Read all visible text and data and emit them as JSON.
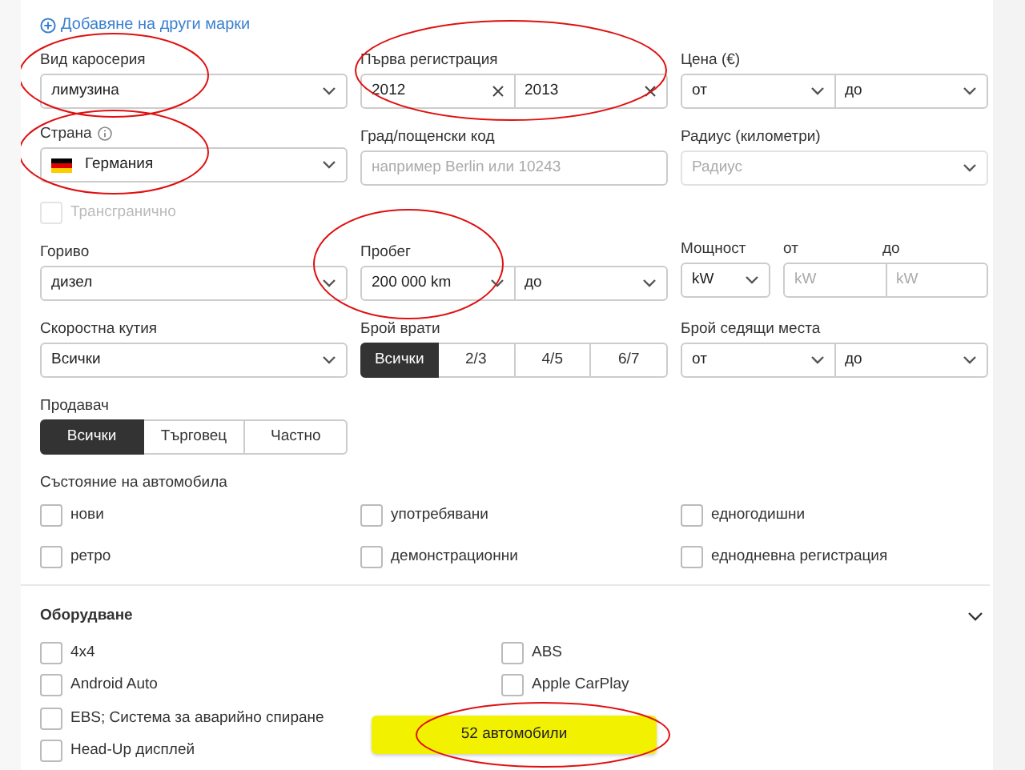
{
  "add_makes_link": "Добавяне на други марки",
  "filters": [
    {
      "kind": "select",
      "label": "Вид каросерия",
      "value": "лимузина",
      "circled": true
    },
    {
      "kind": "range_input",
      "label": "Първа регистрация",
      "from": "2012",
      "to": "2013",
      "circled": true
    },
    {
      "kind": "range_select",
      "label": "Цена (€)",
      "from": "от",
      "to": "до",
      "circled": false
    },
    {
      "kind": "country",
      "label": "Страна",
      "value": "Германия",
      "circled": true
    },
    {
      "kind": "text",
      "label": "Град/пощенски код",
      "placeholder": "например Berlin или 10243",
      "circled": false
    },
    {
      "kind": "select",
      "label": "Радиус (километри)",
      "placeholder": "Радиус",
      "disabled": true,
      "circled": false
    },
    {
      "kind": "checkbox",
      "label": "Трансгранично",
      "checked": false,
      "disabled": true
    },
    {
      "kind": "select",
      "label": "Гориво",
      "value": "дизел",
      "circled": false
    },
    {
      "kind": "range_select",
      "label": "Пробег",
      "from": "200 000 km",
      "to": "до",
      "circled": true
    },
    {
      "kind": "power",
      "label": "Мощност",
      "unit": "kW",
      "from_label": "от",
      "to_label": "до",
      "from_placeholder": "kW",
      "to_placeholder": "kW",
      "circled": false
    },
    {
      "kind": "select",
      "label": "Скоростна кутия",
      "value": "Всички",
      "circled": false
    },
    {
      "kind": "segmented",
      "label": "Брой врати",
      "options": [
        {
          "label": "Всички",
          "selected": true
        },
        {
          "label": "2/3",
          "selected": false
        },
        {
          "label": "4/5",
          "selected": false
        },
        {
          "label": "6/7",
          "selected": false
        }
      ],
      "circled": false
    },
    {
      "kind": "range_select",
      "label": "Брой седящи места",
      "from": "от",
      "to": "до",
      "circled": false
    },
    {
      "kind": "segmented",
      "label": "Продавач",
      "options": [
        {
          "label": "Всички",
          "selected": true
        },
        {
          "label": "Търговец",
          "selected": false
        },
        {
          "label": "Частно",
          "selected": false
        }
      ],
      "circled": false
    },
    {
      "kind": "checkbox_group",
      "label": "Състояние на автомобила",
      "items": [
        {
          "label": "нови",
          "checked": false
        },
        {
          "label": "употребявани",
          "checked": false
        },
        {
          "label": "едногодишни",
          "checked": false
        },
        {
          "label": "ретро",
          "checked": false
        },
        {
          "label": "демонстрационни",
          "checked": false
        },
        {
          "label": "еднодневна регистрация",
          "checked": false
        }
      ]
    }
  ],
  "equipment": {
    "title": "Оборудване",
    "expanded": true,
    "columns": [
      [
        {
          "label": "4x4",
          "checked": false
        },
        {
          "label": "Android Auto",
          "checked": false
        },
        {
          "label": "EBS; Система за аварийно спиране",
          "checked": false
        },
        {
          "label": "Head-Up дисплей",
          "checked": false
        }
      ],
      [
        {
          "label": "ABS",
          "checked": false
        },
        {
          "label": "Apple CarPlay",
          "checked": false
        }
      ]
    ]
  },
  "results_button": {
    "label": "52 автомобили",
    "circled": true
  }
}
